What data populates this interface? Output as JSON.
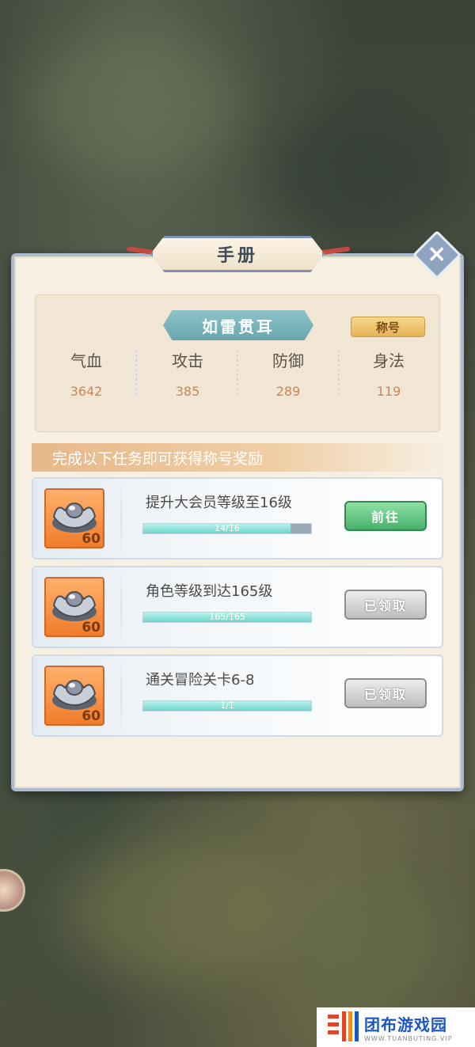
{
  "panel": {
    "title": "手册"
  },
  "stats": {
    "title_name": "如雷贯耳",
    "badge_label": "称号",
    "items": [
      {
        "label": "气血",
        "value": "3642"
      },
      {
        "label": "攻击",
        "value": "385"
      },
      {
        "label": "防御",
        "value": "289"
      },
      {
        "label": "身法",
        "value": "119"
      }
    ]
  },
  "section": {
    "heading": "完成以下任务即可获得称号奖励"
  },
  "tasks": [
    {
      "name": "提升大会员等级至16级",
      "progress_text": "14/16",
      "progress": 0.875,
      "reward_qty": "60",
      "button": "前往",
      "button_state": "go"
    },
    {
      "name": "角色等级到达165级",
      "progress_text": "165/165",
      "progress": 1.0,
      "reward_qty": "60",
      "button": "已领取",
      "button_state": "done"
    },
    {
      "name": "通关冒险关卡6-8",
      "progress_text": "1/1",
      "progress": 1.0,
      "reward_qty": "60",
      "button": "已领取",
      "button_state": "done"
    }
  ],
  "icons": {
    "close": "close-icon",
    "reward": "silver-ingot-icon"
  },
  "colors": {
    "go_button": "#46b06a",
    "done_button": "#bdbdbd",
    "progress_fill": "#6fd3cb",
    "reward_bg": "#f07c2a"
  },
  "watermark": {
    "main": "团布游戏园",
    "sub": "WWW.TUANBUTING.VIP"
  }
}
